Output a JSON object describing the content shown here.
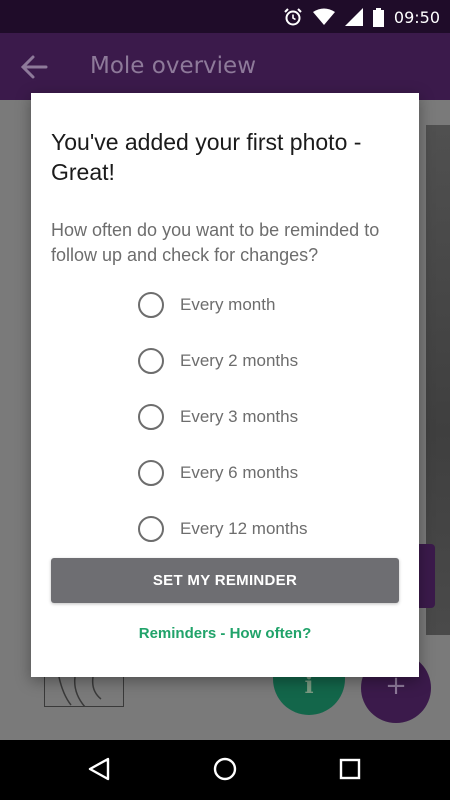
{
  "status_bar": {
    "time": "09:50",
    "icons": [
      "alarm-icon",
      "wifi-icon",
      "signal-icon",
      "battery-icon"
    ]
  },
  "app_bar": {
    "title": "Mole overview",
    "back_icon": "arrow-left-icon"
  },
  "dialog": {
    "title": "You've added your first photo - Great!",
    "question": "How often do you want to be reminded to follow up and check for changes?",
    "options": [
      "Every month",
      "Every 2 months",
      "Every 3 months",
      "Every 6 months",
      "Every 12 months"
    ],
    "selected_option": null,
    "primary_button": "SET MY REMINDER",
    "help_link": "Reminders - How often?"
  },
  "background": {
    "fab_info_icon": "info-icon",
    "fab_add_icon": "plus-icon"
  },
  "navigation_bar": {
    "icons": [
      "back-triangle-icon",
      "home-circle-icon",
      "recents-square-icon"
    ]
  },
  "colors": {
    "app_bar": "#3b1a4b",
    "status_bar": "#1f0c29",
    "button": "#6e6e72",
    "link": "#21a36a",
    "info_fab": "#13664a"
  }
}
